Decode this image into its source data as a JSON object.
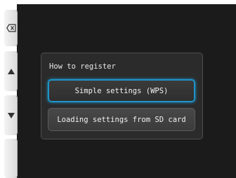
{
  "side_buttons": {
    "back_icon": "backspace-icon",
    "up_icon": "triangle-up-icon",
    "down_icon": "triangle-down-icon"
  },
  "dialog": {
    "title": "How to register",
    "options": [
      {
        "label": "Simple settings (WPS)",
        "selected": true
      },
      {
        "label": "Loading settings from SD card",
        "selected": false
      }
    ]
  },
  "colors": {
    "selection_border": "#1e94c8",
    "screen_background": "#1b1b1b",
    "dialog_background": "#2b2b2b"
  }
}
